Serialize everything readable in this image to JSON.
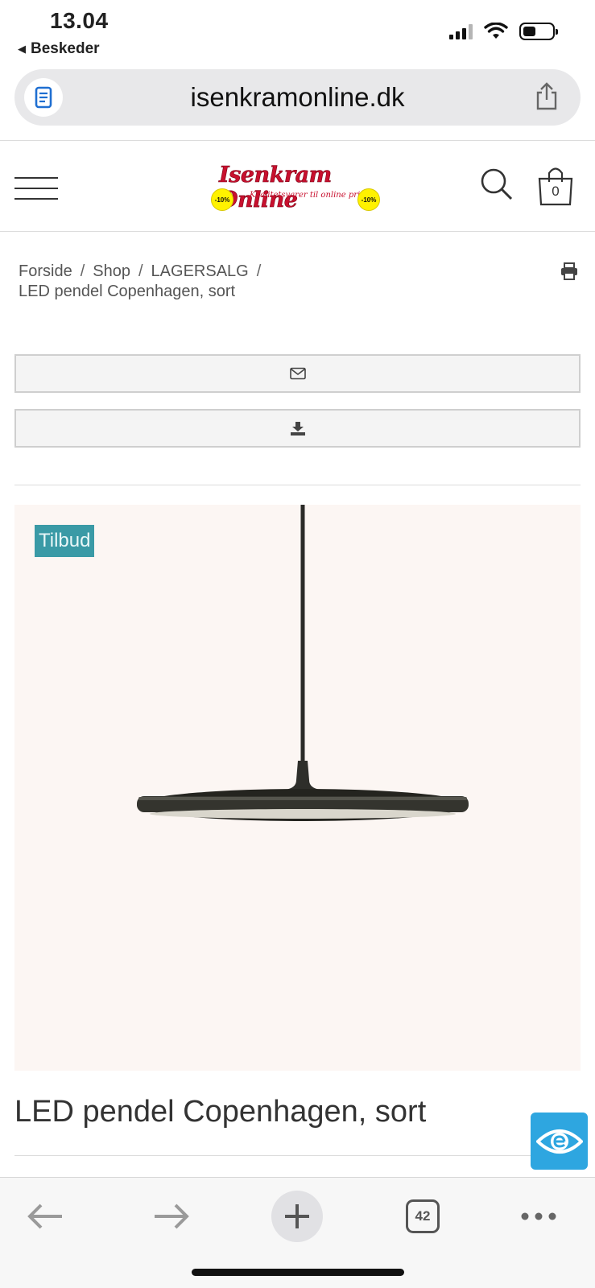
{
  "status_bar": {
    "time": "13.04",
    "back_app": "Beskeder"
  },
  "browser": {
    "url": "isenkramonline.dk",
    "tab_count": "42"
  },
  "site": {
    "logo_text": "Isenkram Online",
    "logo_tagline": "Kvalitetsvarer til online priser...",
    "logo_badge": "-10%",
    "cart_count": "0"
  },
  "breadcrumb": {
    "items": [
      "Forside",
      "Shop",
      "LAGERSALG"
    ],
    "separator": "/",
    "current": "LED pendel Copenhagen, sort"
  },
  "product": {
    "badge": "Tilbud",
    "badge_color": "#3a9aa6",
    "title": "LED pendel Copenhagen, sort",
    "image_icon": "pendant-lamp-image"
  },
  "colors": {
    "accent_eye": "#2ea6e0",
    "image_bg": "#fcf6f3"
  }
}
